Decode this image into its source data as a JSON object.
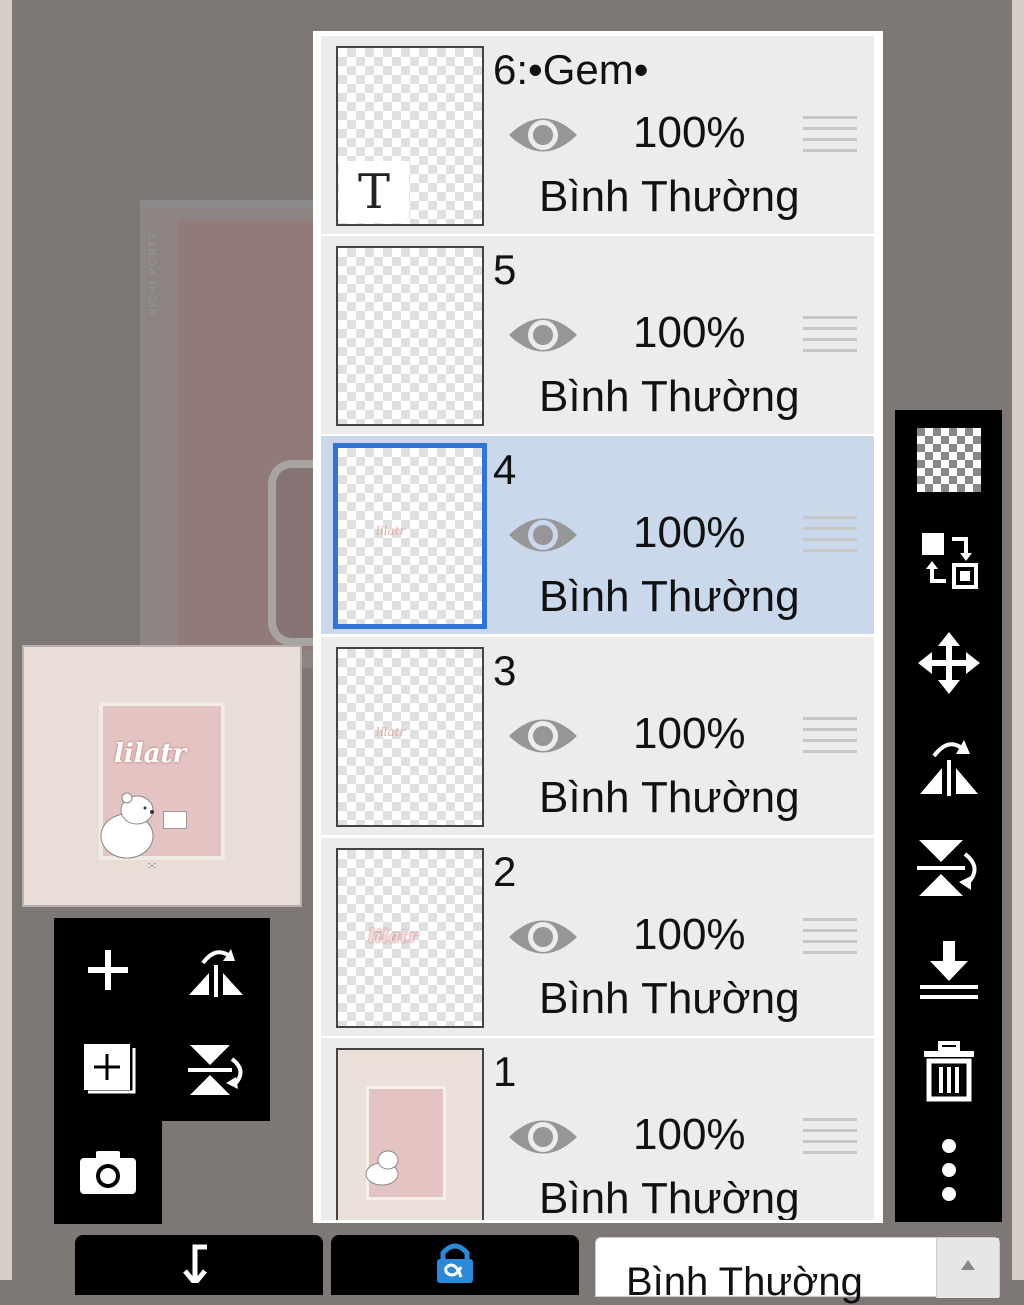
{
  "layers": [
    {
      "name": "6:•Gem•",
      "opacity": "100%",
      "blend": "Bình Thường",
      "visible": true,
      "selected": false
    },
    {
      "name": "5",
      "opacity": "100%",
      "blend": "Bình Thường",
      "visible": true,
      "selected": false
    },
    {
      "name": "4",
      "opacity": "100%",
      "blend": "Bình Thường",
      "visible": true,
      "selected": true
    },
    {
      "name": "3",
      "opacity": "100%",
      "blend": "Bình Thường",
      "visible": true,
      "selected": false
    },
    {
      "name": "2",
      "opacity": "100%",
      "blend": "Bình Thường",
      "visible": true,
      "selected": false
    },
    {
      "name": "1",
      "opacity": "100%",
      "blend": "Bình Thường",
      "visible": true,
      "selected": false
    }
  ],
  "layer_thumbs": {
    "text_badge": "T",
    "logo": "lilatr"
  },
  "navigator": {
    "title": "lilatr",
    "caption": ":-:"
  },
  "background": {
    "vertical_text": "NICHI PORTE"
  },
  "blend_select": {
    "value": "Bình Thường"
  },
  "colors": {
    "selected_row": "#cad8ec",
    "selected_border": "#2f74d6",
    "toolbar": "#000000",
    "alpha_lock": "#2a8ad8"
  },
  "icons": {
    "right_toolbar": [
      "transparency-icon",
      "swap-layers-icon",
      "move-icon",
      "flip-horizontal-icon",
      "flip-vertical-icon",
      "merge-down-icon",
      "trash-icon",
      "more-icon"
    ],
    "left_toolbox": [
      "add-layer-icon",
      "flip-horizontal-icon",
      "add-copy-layer-icon",
      "flip-vertical-icon",
      "camera-icon"
    ],
    "bottom_bar": [
      "clip-icon",
      "alpha-lock-icon"
    ]
  }
}
